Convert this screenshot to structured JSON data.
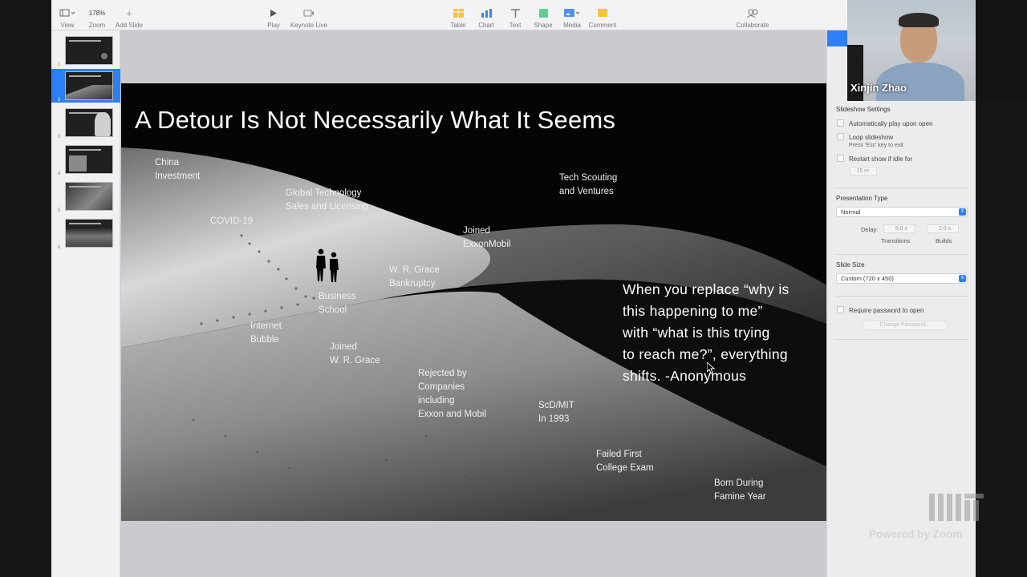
{
  "toolbar": {
    "view": "View",
    "zoom_value": "178%",
    "zoom": "Zoom",
    "add_slide": "Add Slide",
    "play": "Play",
    "keynote_live": "Keynote Live",
    "table": "Table",
    "chart": "Chart",
    "text": "Text",
    "shape": "Shape",
    "media": "Media",
    "comment": "Comment",
    "collaborate": "Collaborate"
  },
  "navigator": {
    "slides": [
      "1",
      "2",
      "3",
      "4",
      "5",
      "6"
    ],
    "selected_index": 1
  },
  "slide": {
    "title": "A Detour Is Not Necessarily What It Seems",
    "labels": {
      "china": "China\nInvestment",
      "global": "Global Technology\nSales and Licensing",
      "covid": "COVID-19",
      "tech": "Tech Scouting\nand Ventures",
      "exxon": "Joined\nExxonMobil",
      "grace_bk": "W. R. Grace\nBankruptcy",
      "business": "Business\nSchool",
      "internet": "Internet\nBubble",
      "grace": "Joined\nW. R. Grace",
      "rejected": "Rejected by\nCompanies\nincluding\nExxon and Mobil",
      "scd": "ScD/MIT\nIn 1993",
      "failed": "Failed First\nCollege Exam",
      "born": "Born During\nFamine Year"
    },
    "quote": "When you replace “why is\nthis happening to me”\nwith “what is this trying\nto reach me?”, everything\nshifts.        -Anonymous"
  },
  "inspector": {
    "slideshow_settings": "Slideshow Settings",
    "auto_play": "Automatically play upon open",
    "loop": "Loop slideshow",
    "loop_sub": "Press ‘Esc’ key to exit",
    "restart": "Restart show if idle for",
    "idle_value": "15 m",
    "presentation_type": "Presentation Type",
    "type_value": "Normal",
    "delay": "Delay:",
    "transitions_value": "5.0 s",
    "builds_value": "2.0 s",
    "transitions": "Transitions",
    "builds": "Builds",
    "slide_size": "Slide Size",
    "size_value": "Custom (720 x 450)",
    "require_password": "Require password to open",
    "change_password": "Change Password..."
  },
  "video": {
    "participant_name": "Xinjin Zhao",
    "powered_by": "Powered by Zoom"
  }
}
